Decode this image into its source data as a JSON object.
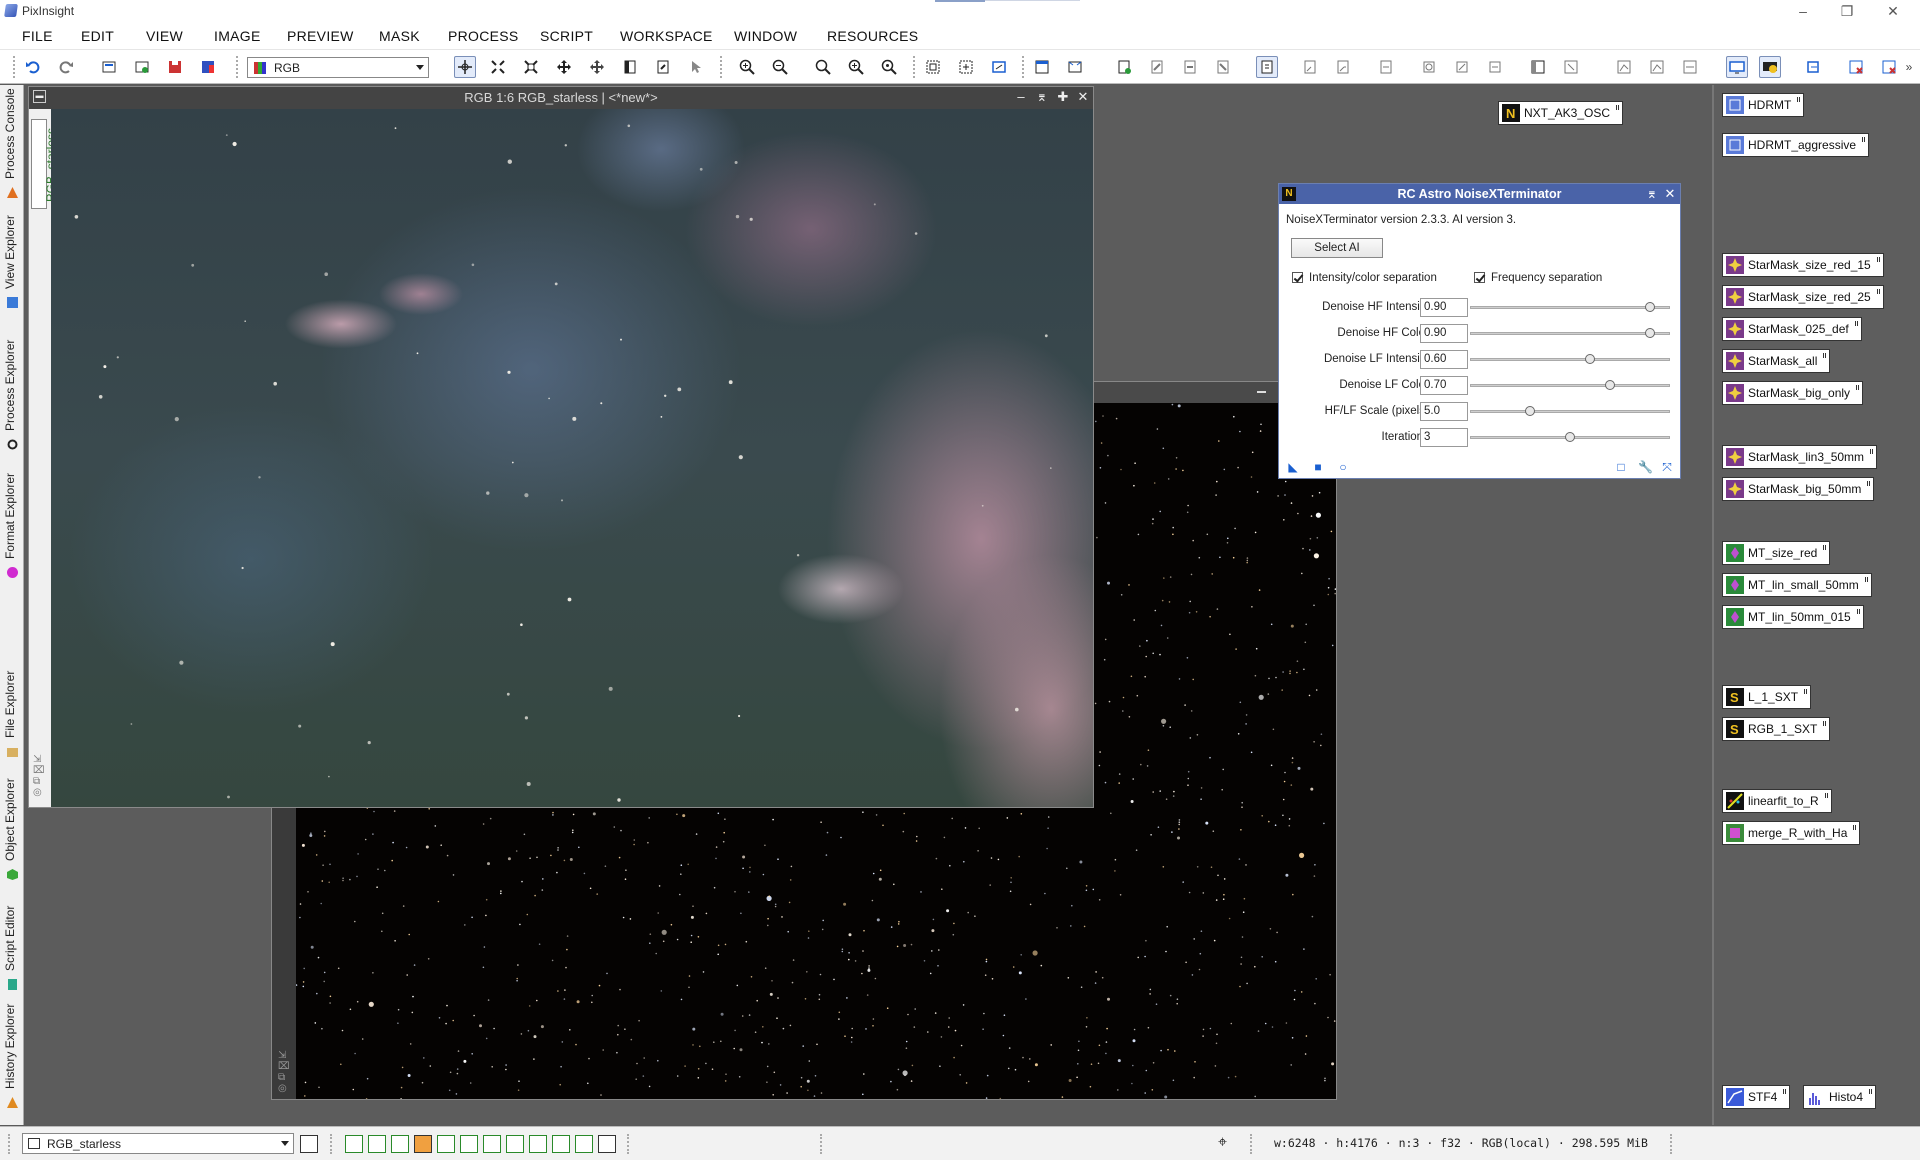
{
  "app": {
    "title": "PixInsight"
  },
  "menu": [
    "FILE",
    "EDIT",
    "VIEW",
    "IMAGE",
    "PREVIEW",
    "MASK",
    "PROCESS",
    "SCRIPT",
    "WORKSPACE",
    "WINDOW",
    "RESOURCES"
  ],
  "toolbar": {
    "view_selector": "RGB"
  },
  "left_dock": [
    "Process Console",
    "View Explorer",
    "Process Explorer",
    "Format Explorer",
    "File Explorer",
    "Object Explorer",
    "Script Editor",
    "History Explorer"
  ],
  "image_window": {
    "title": "RGB 1:6 RGB_starless | <*new*>",
    "side_tab": "RGB_starless"
  },
  "dialog": {
    "title": "RC Astro NoiseXTerminator",
    "version_text": "NoiseXTerminator version 2.3.3. AI version 3.",
    "select_ai_label": "Select AI",
    "checkbox_intensity": "Intensity/color separation",
    "checkbox_frequency": "Frequency separation",
    "params": [
      {
        "label": "Denoise HF Intensity:",
        "value": "0.90",
        "fraction": 0.9
      },
      {
        "label": "Denoise HF Color:",
        "value": "0.90",
        "fraction": 0.9
      },
      {
        "label": "Denoise LF Intensity:",
        "value": "0.60",
        "fraction": 0.6
      },
      {
        "label": "Denoise LF Color:",
        "value": "0.70",
        "fraction": 0.7
      },
      {
        "label": "HF/LF Scale (pixels):",
        "value": "5.0",
        "fraction": 0.3
      },
      {
        "label": "Iterations:",
        "value": "3",
        "fraction": 0.5
      }
    ]
  },
  "icons": {
    "nxt": "NXT_AK3_OSC",
    "hdrmt": "HDRMT",
    "hdrmt_aggr": "HDRMT_aggressive",
    "sm1": "StarMask_size_red_15",
    "sm2": "StarMask_size_red_25",
    "sm3": "StarMask_025_def",
    "sm4": "StarMask_all",
    "sm5": "StarMask_big_only",
    "sm6": "StarMask_lin3_50mm",
    "sm7": "StarMask_big_50mm",
    "mt1": "MT_size_red",
    "mt2": "MT_lin_small_50mm",
    "mt3": "MT_lin_50mm_015",
    "sxt1": "L_1_SXT",
    "sxt2": "RGB_1_SXT",
    "lf": "linearfit_to_R",
    "merge": "merge_R_with_Ha",
    "stf": "STF4",
    "histo": "Histo4"
  },
  "status": {
    "view": "RGB_starless",
    "info": "w:6248 · h:4176 · n:3 · f32 · RGB(local) · 298.595 MiB"
  },
  "colors": {
    "dialog_header": "#4a63a8",
    "accent_blue": "#1a5fd0"
  }
}
